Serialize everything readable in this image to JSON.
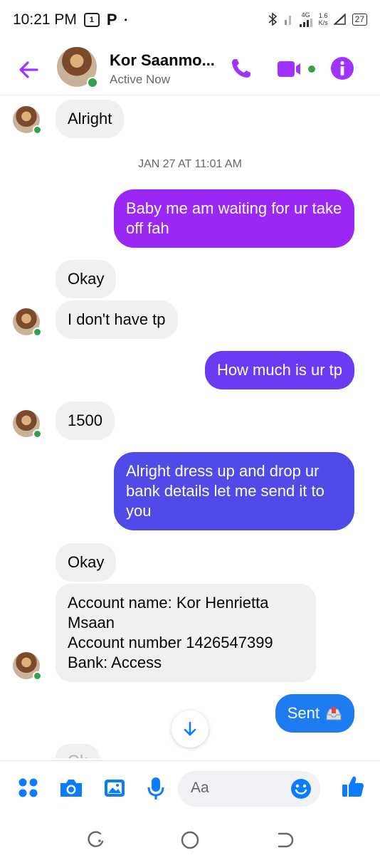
{
  "status_bar": {
    "time": "10:21 PM",
    "app_badge": "[1]",
    "p_icon_label": "P",
    "dot": "•",
    "net_type": "4G",
    "speed_value": "1.6",
    "speed_unit": "K/s",
    "battery": "27"
  },
  "header": {
    "contact_name": "Kor Saanmo...",
    "status": "Active Now",
    "accent_color": "#a033ff"
  },
  "conversation": {
    "first_in": "Alright",
    "timestamp": "JAN 27 AT 11:01 AM",
    "out_1": "Baby me am waiting for ur take off fah",
    "in_okay_1": "Okay",
    "in_tp": "I don't have tp",
    "out_2": "How much is ur tp",
    "in_amount": "1500",
    "out_3": "Alright dress up and drop ur bank details let me send it to you",
    "in_okay_2": "Okay",
    "bank_lines": [
      "Account name: Kor Henrietta",
      "Msaan",
      "Account number 1426547399",
      "Bank: Access"
    ],
    "out_4": "Sent",
    "partial_next": "Ok"
  },
  "colors": {
    "out_purple": "#9b27f5",
    "out_violet": "#6a3bf2",
    "out_indigo": "#4f4ae8",
    "out_blue": "#1e7cf2",
    "icon_blue": "#0a7cff",
    "incoming_bg": "#f0f0f3"
  },
  "composer": {
    "placeholder": "Aa",
    "icons": [
      "grid-menu-icon",
      "camera-icon",
      "gallery-icon",
      "microphone-icon",
      "emoji-icon",
      "thumbs-up-icon"
    ]
  },
  "navigation_bar": {
    "buttons": [
      "recents-icon",
      "home-icon",
      "back-nav-icon"
    ]
  }
}
